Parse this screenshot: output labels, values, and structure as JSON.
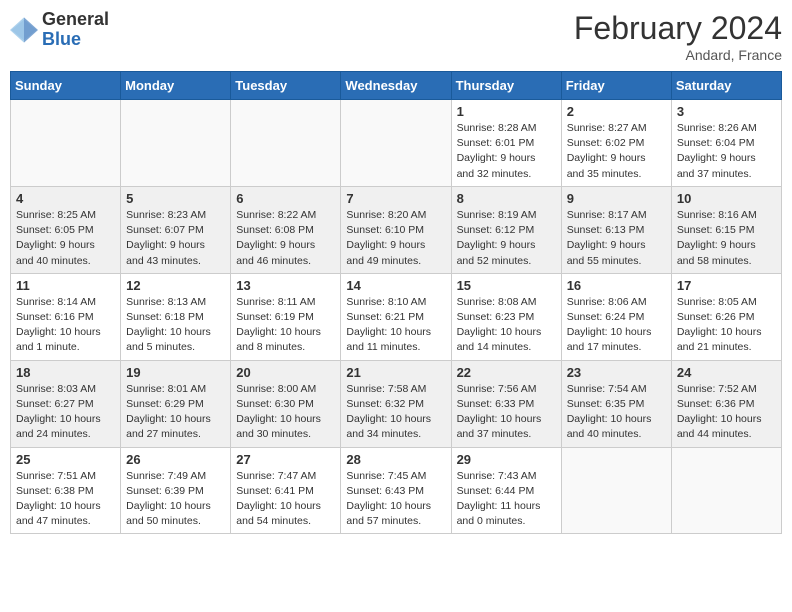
{
  "logo": {
    "general": "General",
    "blue": "Blue"
  },
  "title": {
    "month_year": "February 2024",
    "location": "Andard, France"
  },
  "weekdays": [
    "Sunday",
    "Monday",
    "Tuesday",
    "Wednesday",
    "Thursday",
    "Friday",
    "Saturday"
  ],
  "weeks": [
    [
      {
        "day": "",
        "info": "",
        "empty": true
      },
      {
        "day": "",
        "info": "",
        "empty": true
      },
      {
        "day": "",
        "info": "",
        "empty": true
      },
      {
        "day": "",
        "info": "",
        "empty": true
      },
      {
        "day": "1",
        "info": "Sunrise: 8:28 AM\nSunset: 6:01 PM\nDaylight: 9 hours and 32 minutes.",
        "empty": false
      },
      {
        "day": "2",
        "info": "Sunrise: 8:27 AM\nSunset: 6:02 PM\nDaylight: 9 hours and 35 minutes.",
        "empty": false
      },
      {
        "day": "3",
        "info": "Sunrise: 8:26 AM\nSunset: 6:04 PM\nDaylight: 9 hours and 37 minutes.",
        "empty": false
      }
    ],
    [
      {
        "day": "4",
        "info": "Sunrise: 8:25 AM\nSunset: 6:05 PM\nDaylight: 9 hours and 40 minutes.",
        "empty": false
      },
      {
        "day": "5",
        "info": "Sunrise: 8:23 AM\nSunset: 6:07 PM\nDaylight: 9 hours and 43 minutes.",
        "empty": false
      },
      {
        "day": "6",
        "info": "Sunrise: 8:22 AM\nSunset: 6:08 PM\nDaylight: 9 hours and 46 minutes.",
        "empty": false
      },
      {
        "day": "7",
        "info": "Sunrise: 8:20 AM\nSunset: 6:10 PM\nDaylight: 9 hours and 49 minutes.",
        "empty": false
      },
      {
        "day": "8",
        "info": "Sunrise: 8:19 AM\nSunset: 6:12 PM\nDaylight: 9 hours and 52 minutes.",
        "empty": false
      },
      {
        "day": "9",
        "info": "Sunrise: 8:17 AM\nSunset: 6:13 PM\nDaylight: 9 hours and 55 minutes.",
        "empty": false
      },
      {
        "day": "10",
        "info": "Sunrise: 8:16 AM\nSunset: 6:15 PM\nDaylight: 9 hours and 58 minutes.",
        "empty": false
      }
    ],
    [
      {
        "day": "11",
        "info": "Sunrise: 8:14 AM\nSunset: 6:16 PM\nDaylight: 10 hours and 1 minute.",
        "empty": false
      },
      {
        "day": "12",
        "info": "Sunrise: 8:13 AM\nSunset: 6:18 PM\nDaylight: 10 hours and 5 minutes.",
        "empty": false
      },
      {
        "day": "13",
        "info": "Sunrise: 8:11 AM\nSunset: 6:19 PM\nDaylight: 10 hours and 8 minutes.",
        "empty": false
      },
      {
        "day": "14",
        "info": "Sunrise: 8:10 AM\nSunset: 6:21 PM\nDaylight: 10 hours and 11 minutes.",
        "empty": false
      },
      {
        "day": "15",
        "info": "Sunrise: 8:08 AM\nSunset: 6:23 PM\nDaylight: 10 hours and 14 minutes.",
        "empty": false
      },
      {
        "day": "16",
        "info": "Sunrise: 8:06 AM\nSunset: 6:24 PM\nDaylight: 10 hours and 17 minutes.",
        "empty": false
      },
      {
        "day": "17",
        "info": "Sunrise: 8:05 AM\nSunset: 6:26 PM\nDaylight: 10 hours and 21 minutes.",
        "empty": false
      }
    ],
    [
      {
        "day": "18",
        "info": "Sunrise: 8:03 AM\nSunset: 6:27 PM\nDaylight: 10 hours and 24 minutes.",
        "empty": false
      },
      {
        "day": "19",
        "info": "Sunrise: 8:01 AM\nSunset: 6:29 PM\nDaylight: 10 hours and 27 minutes.",
        "empty": false
      },
      {
        "day": "20",
        "info": "Sunrise: 8:00 AM\nSunset: 6:30 PM\nDaylight: 10 hours and 30 minutes.",
        "empty": false
      },
      {
        "day": "21",
        "info": "Sunrise: 7:58 AM\nSunset: 6:32 PM\nDaylight: 10 hours and 34 minutes.",
        "empty": false
      },
      {
        "day": "22",
        "info": "Sunrise: 7:56 AM\nSunset: 6:33 PM\nDaylight: 10 hours and 37 minutes.",
        "empty": false
      },
      {
        "day": "23",
        "info": "Sunrise: 7:54 AM\nSunset: 6:35 PM\nDaylight: 10 hours and 40 minutes.",
        "empty": false
      },
      {
        "day": "24",
        "info": "Sunrise: 7:52 AM\nSunset: 6:36 PM\nDaylight: 10 hours and 44 minutes.",
        "empty": false
      }
    ],
    [
      {
        "day": "25",
        "info": "Sunrise: 7:51 AM\nSunset: 6:38 PM\nDaylight: 10 hours and 47 minutes.",
        "empty": false
      },
      {
        "day": "26",
        "info": "Sunrise: 7:49 AM\nSunset: 6:39 PM\nDaylight: 10 hours and 50 minutes.",
        "empty": false
      },
      {
        "day": "27",
        "info": "Sunrise: 7:47 AM\nSunset: 6:41 PM\nDaylight: 10 hours and 54 minutes.",
        "empty": false
      },
      {
        "day": "28",
        "info": "Sunrise: 7:45 AM\nSunset: 6:43 PM\nDaylight: 10 hours and 57 minutes.",
        "empty": false
      },
      {
        "day": "29",
        "info": "Sunrise: 7:43 AM\nSunset: 6:44 PM\nDaylight: 11 hours and 0 minutes.",
        "empty": false
      },
      {
        "day": "",
        "info": "",
        "empty": true
      },
      {
        "day": "",
        "info": "",
        "empty": true
      }
    ]
  ]
}
